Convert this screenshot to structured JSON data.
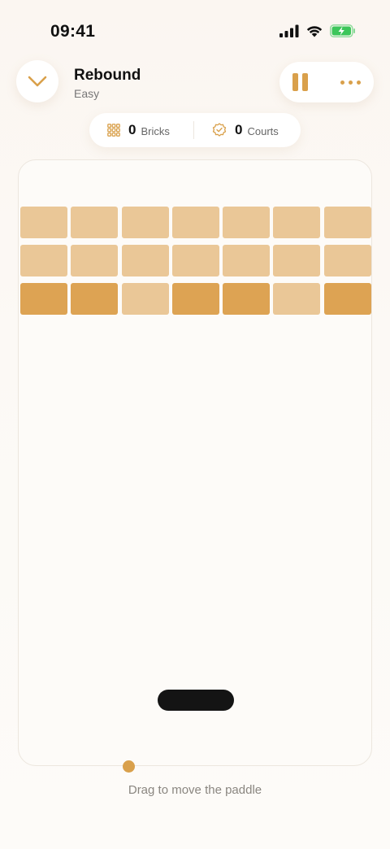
{
  "status_bar": {
    "time": "09:41",
    "icons": [
      "cellular-signal-icon",
      "wifi-icon",
      "battery-charging-icon"
    ],
    "battery_color": "#3cc65a"
  },
  "header": {
    "title": "Rebound",
    "subtitle": "Easy",
    "back_icon": "chevron-down-icon",
    "actions": [
      "pause-icon",
      "more-icon"
    ]
  },
  "stats": {
    "bricks_count": "0",
    "bricks_label": "Bricks",
    "courts_count": "0",
    "courts_label": "Courts"
  },
  "game": {
    "brick_rows": [
      [
        "light",
        "light",
        "light",
        "light",
        "light",
        "light",
        "light"
      ],
      [
        "light",
        "light",
        "light",
        "light",
        "light",
        "light",
        "light"
      ],
      [
        "dark",
        "dark",
        "light",
        "dark",
        "dark",
        "light",
        "dark"
      ]
    ],
    "colors": {
      "accent": "#d9a04b",
      "brick_light": "#eac797",
      "brick_dark": "#dda353",
      "paddle": "#141414"
    }
  },
  "hint": "Drag to move the paddle"
}
